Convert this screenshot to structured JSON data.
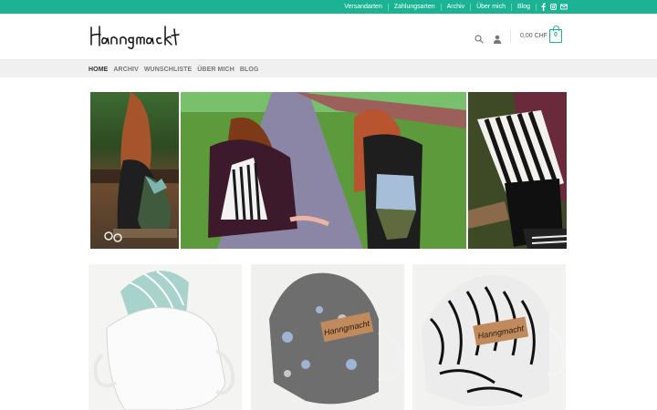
{
  "topbar": {
    "links": [
      "Versandarten",
      "Zahlungsarten",
      "Archiv",
      "Über mich",
      "Blog"
    ],
    "social_icons": [
      "facebook-icon",
      "instagram-icon",
      "email-icon"
    ]
  },
  "header": {
    "logo_text": "Hanngmacht",
    "cart_total": "0,00 CHF",
    "cart_count": "0"
  },
  "mainnav": {
    "items": [
      {
        "label": "HOME",
        "active": true
      },
      {
        "label": "ARCHIV",
        "active": false
      },
      {
        "label": "WUNSCHLISTE",
        "active": false
      },
      {
        "label": "ÜBER MICH",
        "active": false
      },
      {
        "label": "BLOG",
        "active": false
      }
    ]
  },
  "products": [
    {
      "label": "Hanngmacht"
    },
    {
      "label": "Hanngmacht"
    }
  ],
  "colors": {
    "accent": "#1cb395",
    "topbar_text": "#ffffff",
    "nav_bg": "#f0f0f0"
  }
}
